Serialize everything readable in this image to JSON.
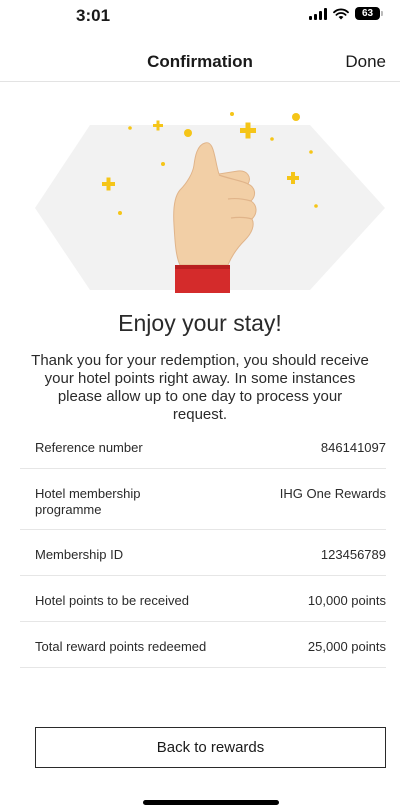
{
  "status_bar": {
    "time": "3:01",
    "battery": "63"
  },
  "nav": {
    "title": "Confirmation",
    "done_label": "Done"
  },
  "illustration": {
    "name": "thumbs-up-illustration",
    "accent_color": "#f5c518",
    "background_color": "#f2f2f2",
    "sleeve_color": "#d42b2b"
  },
  "headline": "Enjoy your stay!",
  "message": "Thank you for your redemption, you should receive your hotel points right away. In some instances please allow up to one day to process your request.",
  "details": [
    {
      "label": "Reference number",
      "value": "846141097"
    },
    {
      "label": "Hotel membership programme",
      "value": "IHG One Rewards"
    },
    {
      "label": "Membership ID",
      "value": "123456789"
    },
    {
      "label": "Hotel points to be received",
      "value": "10,000 points"
    },
    {
      "label": "Total reward points redeemed",
      "value": "25,000 points"
    }
  ],
  "footer": {
    "back_label": "Back to rewards"
  }
}
